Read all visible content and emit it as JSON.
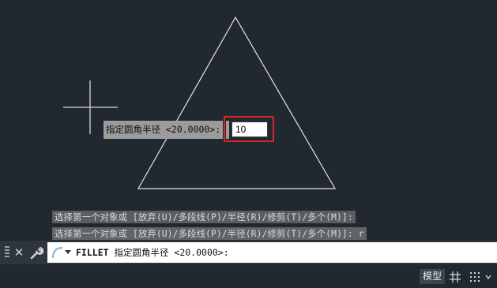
{
  "drawing": {
    "shape": "triangle",
    "line_color": "#e6e6e6",
    "crosshair_color": "#d9d9d9"
  },
  "dynamic_input": {
    "prompt": "指定圆角半径 <20.0000>:",
    "value": "10",
    "highlight_color": "#d62828"
  },
  "command_history": [
    "选择第一个对象或 [放弃(U)/多段线(P)/半径(R)/修剪(T)/多个(M)]:",
    "选择第一个对象或 [放弃(U)/多段线(P)/半径(R)/修剪(T)/多个(M)]: r"
  ],
  "command_line": {
    "command": "FILLET",
    "prompt": "指定圆角半径 <20.0000>:",
    "icons": [
      "grip-icon",
      "close-icon",
      "wrench-icon",
      "recent-commands-icon",
      "dropdown-arrow-icon"
    ]
  },
  "status_bar": {
    "model_label": "模型",
    "icons": [
      "grid-icon",
      "snap-icon",
      "chevron-down-icon"
    ]
  }
}
